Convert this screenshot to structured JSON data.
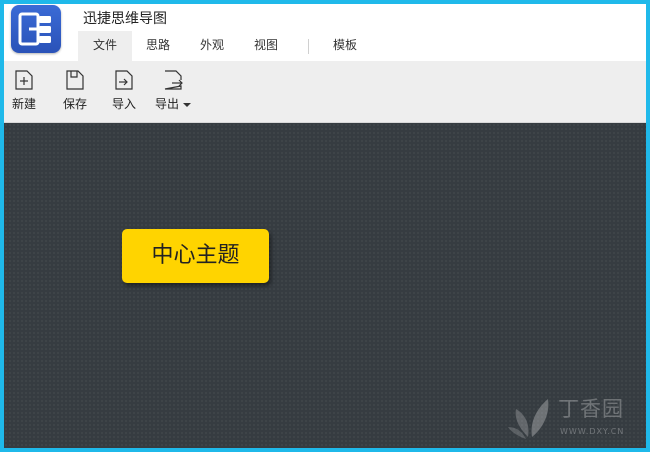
{
  "app": {
    "title": "迅捷思维导图"
  },
  "menu": {
    "tabs": [
      {
        "label": "文件",
        "active": true
      },
      {
        "label": "思路"
      },
      {
        "label": "外观"
      },
      {
        "label": "视图"
      },
      {
        "label": "模板"
      }
    ]
  },
  "toolbar": {
    "new_label": "新建",
    "save_label": "保存",
    "import_label": "导入",
    "export_label": "导出"
  },
  "canvas": {
    "central_topic": "中心主题",
    "topic_color": "#ffd400",
    "background_color": "#363c41"
  },
  "watermark": {
    "text": "丁香园",
    "url": "WWW.DXY.CN"
  },
  "colors": {
    "frame": "#1fb9ea",
    "logo": "#2f5cc4"
  }
}
